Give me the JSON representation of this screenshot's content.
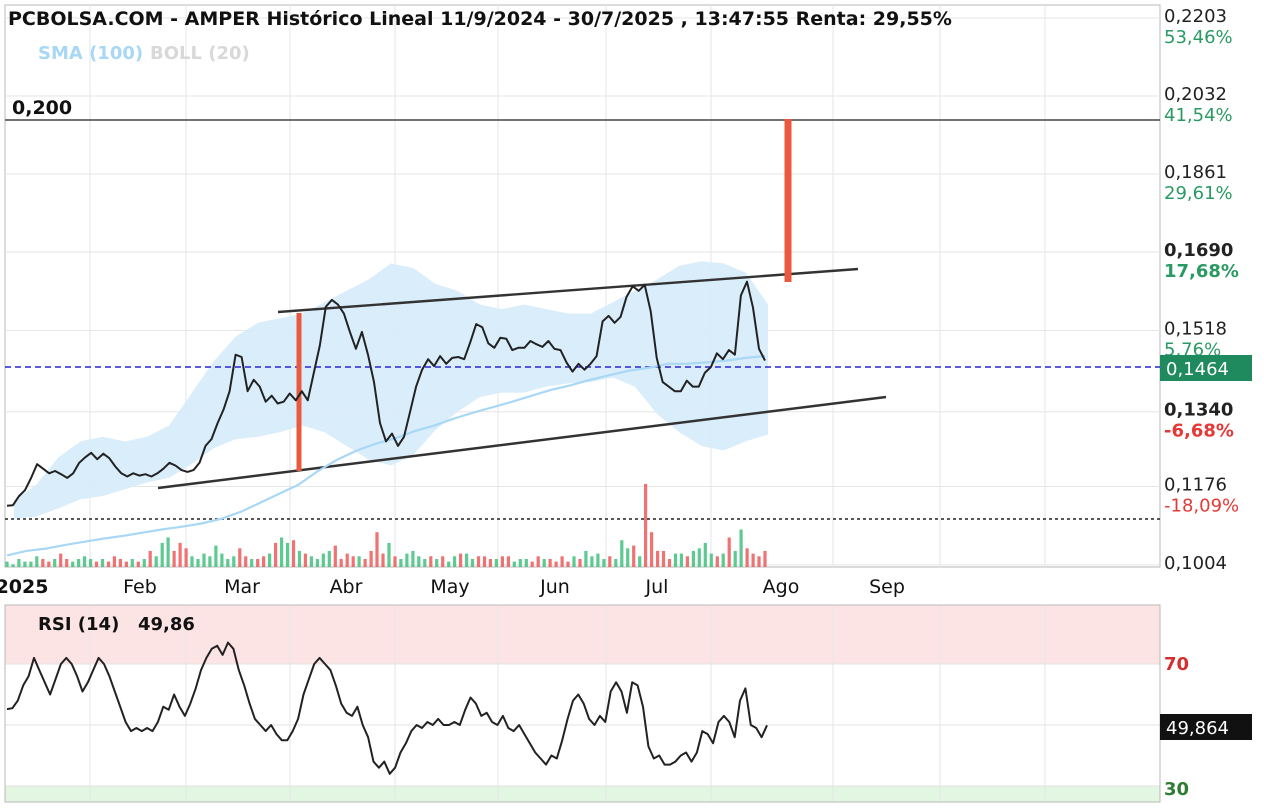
{
  "header": {
    "title": "PCBOLSA.COM - AMPER Histórico Lineal 11/9/2024 - 30/7/2025 , 13:47:55 Renta: 29,55%",
    "sma_label": "SMA (100)",
    "boll_label": "BOLL (20)"
  },
  "annotations": {
    "level_line_label": "0,200",
    "current_price_tag": "0,1464",
    "rsi_title": "RSI (14)",
    "rsi_value": "49,86",
    "rsi_current_tag": "49,864"
  },
  "colors": {
    "price_line": "#222222",
    "sma": "#a8d8f5",
    "bollinger_band": "#d6ebfb",
    "current_price_line": "#2424d8",
    "price_tag_bg": "#1e8a5e",
    "volume_up": "#3fc17e",
    "volume_down": "#ec5a5a",
    "gain_text": "#2a9a63",
    "loss_text": "#e53935",
    "rsi_overbought_zone": "#fde4e4",
    "rsi_oversold_zone": "#e2f6e2",
    "rsi_70_label": "#d32f2f",
    "rsi_30_label": "#2e7d32"
  },
  "chart_data": [
    {
      "type": "line",
      "title": "PCBOLSA.COM - AMPER Histórico Lineal 11/9/2024 - 30/7/2025 , 13:47:55 Renta: 29,55%",
      "x_tick_labels": [
        "2025",
        "Feb",
        "Mar",
        "Abr",
        "May",
        "Jun",
        "Jul",
        "Ago",
        "Sep"
      ],
      "y_ticks": [
        {
          "value": "0,2203",
          "pct": "53,46%",
          "bold": false
        },
        {
          "value": "0,2032",
          "pct": "41,54%",
          "bold": false
        },
        {
          "value": "0,1861",
          "pct": "29,61%",
          "bold": false
        },
        {
          "value": "0,1690",
          "pct": "17,68%",
          "bold": true
        },
        {
          "value": "0,1518",
          "pct": "5,76%",
          "bold": false
        },
        {
          "value": "0,1340",
          "pct": "-6,68%",
          "bold": true
        },
        {
          "value": "0,1176",
          "pct": "-18,09%",
          "bold": false
        },
        {
          "value": "0,1004",
          "pct": "",
          "bold": false
        }
      ],
      "ylim": [
        0.1004,
        0.2203
      ],
      "grid": true,
      "indicators": [
        "SMA (100)",
        "BOLL (20)"
      ],
      "horizontal_levels": [
        0.2,
        0.1464,
        0.114
      ],
      "current_price": 0.1464,
      "series": [
        {
          "name": "AMPER",
          "values": [
            0.1134,
            0.1135,
            0.1155,
            0.1168,
            0.1195,
            0.1225,
            0.1215,
            0.1205,
            0.121,
            0.1203,
            0.1195,
            0.1205,
            0.1228,
            0.124,
            0.125,
            0.1236,
            0.1248,
            0.1238,
            0.122,
            0.1205,
            0.1198,
            0.1205,
            0.12,
            0.1203,
            0.1198,
            0.1205,
            0.1215,
            0.1228,
            0.1222,
            0.1212,
            0.1208,
            0.1212,
            0.1228,
            0.1265,
            0.128,
            0.1315,
            0.1345,
            0.1385,
            0.1465,
            0.146,
            0.1385,
            0.141,
            0.1395,
            0.1362,
            0.1375,
            0.1358,
            0.1362,
            0.138,
            0.1365,
            0.1385,
            0.1365,
            0.1425,
            0.1485,
            0.157,
            0.1585,
            0.1575,
            0.1555,
            0.1515,
            0.1478,
            0.1515,
            0.1465,
            0.1405,
            0.1315,
            0.1275,
            0.1292,
            0.1265,
            0.1285,
            0.134,
            0.1395,
            0.1432,
            0.1455,
            0.144,
            0.1462,
            0.1445,
            0.1458,
            0.146,
            0.1455,
            0.1492,
            0.1532,
            0.1525,
            0.149,
            0.148,
            0.1502,
            0.15,
            0.1475,
            0.148,
            0.148,
            0.1495,
            0.1488,
            0.1482,
            0.1495,
            0.1478,
            0.1475,
            0.1448,
            0.1428,
            0.1445,
            0.1432,
            0.1445,
            0.1462,
            0.1538,
            0.155,
            0.1535,
            0.1548,
            0.1592,
            0.1615,
            0.1605,
            0.1618,
            0.156,
            0.1458,
            0.1405,
            0.1395,
            0.1385,
            0.1385,
            0.1408,
            0.1395,
            0.1395,
            0.1425,
            0.1438,
            0.1468,
            0.1455,
            0.1475,
            0.1465,
            0.1595,
            0.1625,
            0.1568,
            0.1478,
            0.1452
          ]
        },
        {
          "name": "SMA (100)",
          "values": [
            0.1025,
            0.1035,
            0.104,
            0.1048,
            0.1055,
            0.1062,
            0.1068,
            0.1075,
            0.1082,
            0.1088,
            0.1095,
            0.1105,
            0.112,
            0.114,
            0.116,
            0.118,
            0.121,
            0.1235,
            0.1255,
            0.127,
            0.1282,
            0.1298,
            0.131,
            0.1325,
            0.1338,
            0.135,
            0.1362,
            0.1375,
            0.1388,
            0.1398,
            0.141,
            0.142,
            0.143,
            0.1436,
            0.1445,
            0.1445,
            0.1448,
            0.1452,
            0.1458,
            0.1462
          ]
        }
      ],
      "bollinger_band": {
        "upper": [
          0.1145,
          0.118,
          0.124,
          0.1275,
          0.1285,
          0.1275,
          0.1285,
          0.131,
          0.138,
          0.145,
          0.1505,
          0.1535,
          0.1545,
          0.1555,
          0.158,
          0.1605,
          0.163,
          0.1665,
          0.1655,
          0.162,
          0.1605,
          0.1575,
          0.1565,
          0.1575,
          0.1565,
          0.1555,
          0.1555,
          0.158,
          0.1605,
          0.163,
          0.166,
          0.167,
          0.1665,
          0.1645,
          0.1575
        ],
        "lower": [
          0.1105,
          0.111,
          0.1128,
          0.1148,
          0.1155,
          0.117,
          0.1185,
          0.1195,
          0.1225,
          0.126,
          0.128,
          0.1285,
          0.1295,
          0.131,
          0.1295,
          0.1265,
          0.1235,
          0.1222,
          0.1245,
          0.13,
          0.134,
          0.1372,
          0.1382,
          0.1382,
          0.1395,
          0.1402,
          0.1405,
          0.1415,
          0.1395,
          0.1335,
          0.1295,
          0.1265,
          0.1255,
          0.1275,
          0.129
        ]
      },
      "volume": [
        2,
        1,
        3,
        2,
        2,
        4,
        3,
        2,
        3,
        5,
        3,
        2,
        3,
        4,
        3,
        2,
        3,
        2,
        4,
        3,
        2,
        3,
        2,
        3,
        6,
        4,
        9,
        11,
        6,
        9,
        7,
        4,
        3,
        5,
        4,
        8,
        5,
        3,
        4,
        7,
        4,
        3,
        3,
        4,
        5,
        9,
        11,
        9,
        10,
        6,
        5,
        4,
        3,
        5,
        6,
        8,
        3,
        5,
        4,
        4,
        3,
        6,
        13,
        5,
        9,
        4,
        3,
        5,
        6,
        4,
        3,
        4,
        3,
        4,
        2,
        4,
        5,
        5,
        3,
        4,
        4,
        3,
        3,
        4,
        4,
        2,
        3,
        3,
        2,
        4,
        3,
        3,
        2,
        4,
        2,
        4,
        3,
        6,
        4,
        5,
        3,
        4,
        3,
        10,
        7,
        8,
        4,
        31,
        13,
        6,
        6,
        3,
        5,
        5,
        4,
        6,
        7,
        9,
        5,
        4,
        5,
        11,
        6,
        14,
        7,
        5,
        4,
        6
      ]
    },
    {
      "type": "line",
      "title": "RSI (14)",
      "y_ticks": [
        "70",
        "30"
      ],
      "current": 49.86,
      "series": [
        {
          "name": "RSI (14)",
          "values": [
            55.2,
            55.5,
            58,
            63,
            66,
            72,
            68,
            64,
            60,
            65,
            70,
            72,
            70,
            66,
            61,
            64,
            68,
            72,
            70,
            66,
            61,
            56,
            51,
            48,
            49,
            48,
            49,
            48,
            51,
            56,
            55,
            60,
            56,
            53,
            57,
            62,
            68,
            72,
            75,
            76,
            73,
            77,
            75,
            68,
            63,
            57,
            52,
            50,
            48,
            50,
            47,
            45,
            45,
            48,
            52,
            60,
            65,
            70,
            72,
            70,
            68,
            63,
            57,
            54,
            53,
            56,
            50,
            46,
            38,
            36,
            38,
            34,
            36,
            41,
            44,
            48,
            50,
            49,
            51,
            50,
            52,
            50,
            50,
            51,
            50,
            55,
            59,
            57,
            53,
            54,
            51,
            50,
            53,
            49,
            48,
            50,
            47,
            44,
            41,
            39,
            37,
            40,
            39,
            45,
            52,
            58,
            60,
            57,
            52,
            50,
            53,
            51,
            61,
            64,
            61,
            54,
            64,
            63,
            56,
            43,
            39,
            40,
            37,
            37,
            38,
            40,
            41,
            38,
            41,
            48,
            47,
            44,
            51,
            53,
            51,
            46,
            58,
            62,
            50,
            49,
            46,
            49.9
          ]
        }
      ]
    }
  ]
}
